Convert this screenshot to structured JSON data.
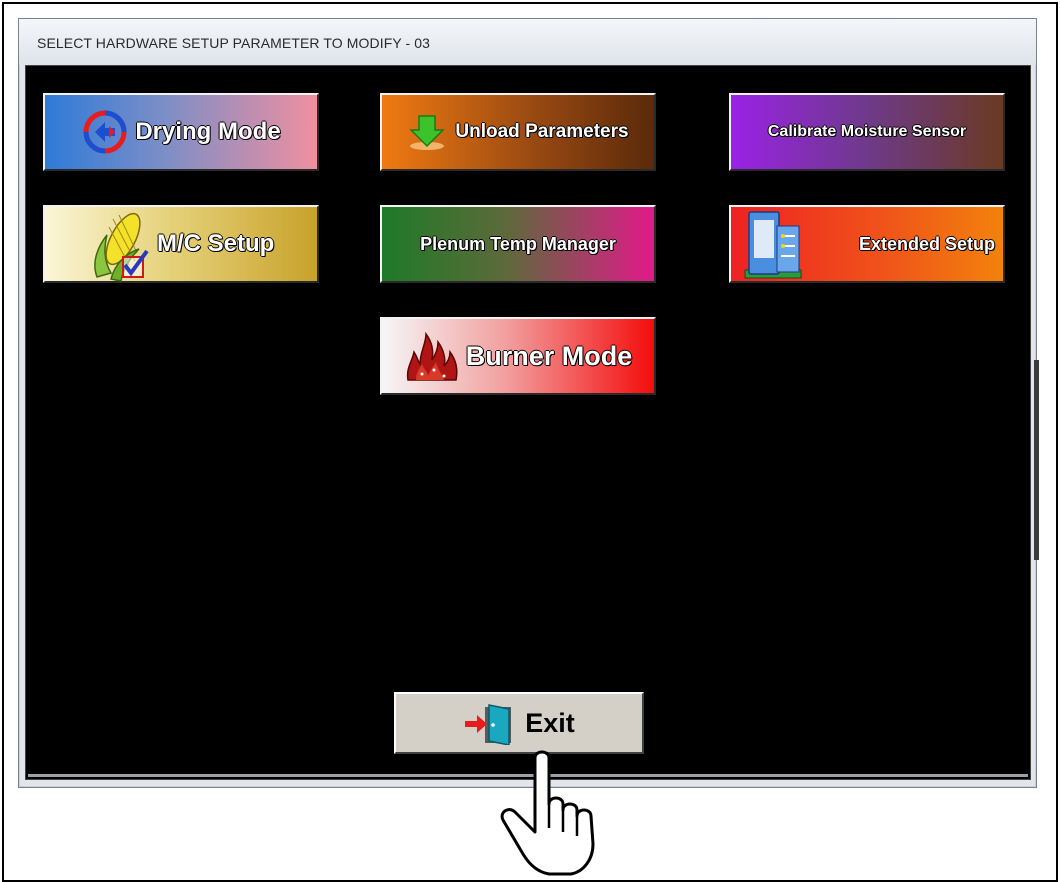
{
  "window": {
    "title": "SELECT HARDWARE SETUP PARAMETER TO MODIFY - 03"
  },
  "buttons": {
    "drying_mode": {
      "label": "Drying Mode",
      "icon": "refresh-cycle-icon"
    },
    "unload_parameters": {
      "label": "Unload Parameters",
      "icon": "down-arrow-icon"
    },
    "calibrate_moisture_sensor": {
      "label": "Calibrate Moisture Sensor"
    },
    "mc_setup": {
      "label": "M/C Setup",
      "icon": "corn-checkmark-icon"
    },
    "plenum_temp_manager": {
      "label": "Plenum Temp Manager"
    },
    "extended_setup": {
      "label": "Extended Setup",
      "icon": "control-panel-icon"
    },
    "burner_mode": {
      "label": "Burner Mode",
      "icon": "flame-icon"
    },
    "exit": {
      "label": "Exit",
      "icon": "exit-door-icon"
    }
  },
  "colors": {
    "background": "#000000",
    "exit_button": "#d4d0c8"
  }
}
